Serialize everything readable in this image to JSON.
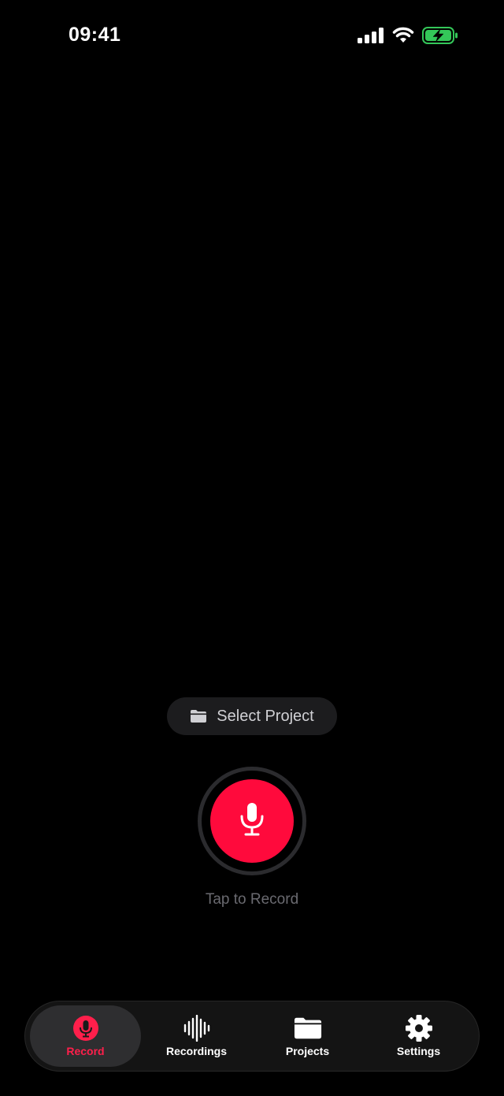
{
  "status_bar": {
    "time": "09:41",
    "icons": [
      "cellular-signal-icon",
      "wifi-icon",
      "battery-charging-icon"
    ],
    "battery_color": "#34c759"
  },
  "project_selector": {
    "label": "Select Project",
    "icon": "folder-icon"
  },
  "record": {
    "hint": "Tap to Record",
    "icon": "microphone-icon",
    "accent_color": "#ff0a3c"
  },
  "tab_bar": {
    "tabs": [
      {
        "label": "Record",
        "icon": "microphone-icon",
        "active": true
      },
      {
        "label": "Recordings",
        "icon": "waveform-icon",
        "active": false
      },
      {
        "label": "Projects",
        "icon": "folder-icon",
        "active": false
      },
      {
        "label": "Settings",
        "icon": "gear-icon",
        "active": false
      }
    ]
  }
}
